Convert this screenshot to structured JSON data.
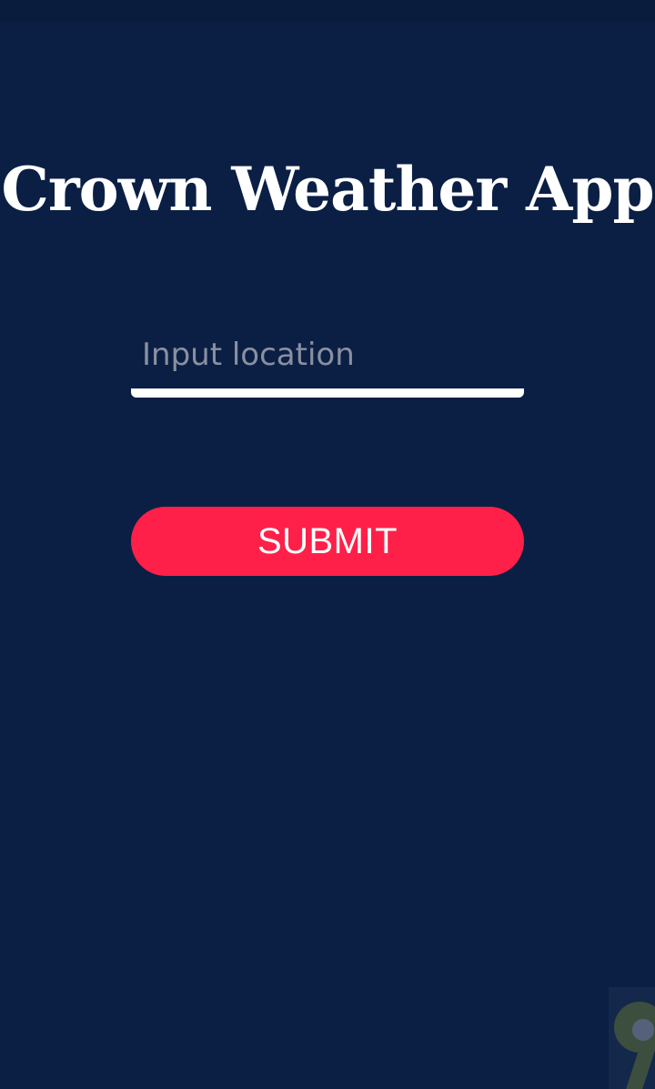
{
  "app": {
    "title": "Crown Weather App"
  },
  "location_input": {
    "placeholder": "Input location",
    "value": ""
  },
  "submit_button": {
    "label": "SUBMIT"
  },
  "colors": {
    "background": "#0b1f45",
    "accent": "#ff2049",
    "text": "#ffffff"
  },
  "icons": {
    "corner_overlay": "floating-assistant-icon"
  }
}
